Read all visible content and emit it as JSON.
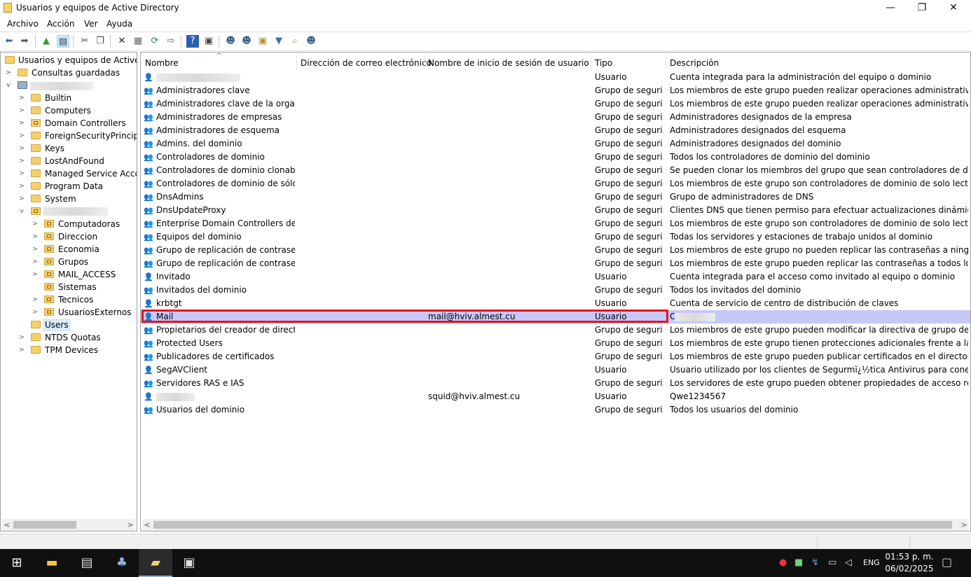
{
  "window": {
    "title": "Usuarios y equipos de Active Directory",
    "minimize": "—",
    "maximize": "❐",
    "close": "✕"
  },
  "menu": [
    "Archivo",
    "Acción",
    "Ver",
    "Ayuda"
  ],
  "toolbar_icons": [
    "back-icon",
    "forward-icon",
    "up-folder-icon",
    "show-hide-tree-icon",
    "cut-icon",
    "copy-icon",
    "delete-icon",
    "properties-icon",
    "refresh-icon",
    "export-list-icon",
    "help-icon",
    "console-tree-icon",
    "new-user-icon",
    "new-group-icon",
    "new-ou-icon",
    "filter-icon",
    "find-icon",
    "add-to-group-icon"
  ],
  "tree": {
    "root": "Usuarios y equipos de Active Directory",
    "items": [
      {
        "label": "Consultas guardadas"
      },
      {
        "label": ""
      },
      {
        "label": "Builtin"
      },
      {
        "label": "Computers"
      },
      {
        "label": "Domain Controllers"
      },
      {
        "label": "ForeignSecurityPrincipals"
      },
      {
        "label": "Keys"
      },
      {
        "label": "LostAndFound"
      },
      {
        "label": "Managed Service Accounts"
      },
      {
        "label": "Program Data"
      },
      {
        "label": "System"
      },
      {
        "label": ""
      },
      {
        "label": "Computadoras"
      },
      {
        "label": "Direccion"
      },
      {
        "label": "Economia"
      },
      {
        "label": "Grupos"
      },
      {
        "label": "MAIL_ACCESS"
      },
      {
        "label": "Sistemas"
      },
      {
        "label": "Tecnicos"
      },
      {
        "label": "UsuariosExternos"
      },
      {
        "label": "Users"
      },
      {
        "label": "NTDS Quotas"
      },
      {
        "label": "TPM Devices"
      }
    ]
  },
  "list": {
    "columns": [
      "Nombre",
      "Dirección de correo electrónico",
      "Nombre de inicio de sesión de usuario",
      "Tipo",
      "Descripción"
    ],
    "rows": [
      {
        "name": "",
        "email": "",
        "login": "",
        "type": "Usuario",
        "desc": "Cuenta integrada para la administración del equipo o dominio",
        "icon": "user"
      },
      {
        "name": "Administradores clave",
        "email": "",
        "login": "",
        "type": "Grupo de seguri...",
        "desc": "Los miembros de este grupo pueden realizar operaciones administrativas en los ...",
        "icon": "group"
      },
      {
        "name": "Administradores clave de la organiz...",
        "email": "",
        "login": "",
        "type": "Grupo de seguri...",
        "desc": "Los miembros de este grupo pueden realizar operaciones administrativas en los ...",
        "icon": "group"
      },
      {
        "name": "Administradores de empresas",
        "email": "",
        "login": "",
        "type": "Grupo de seguri...",
        "desc": "Administradores designados de la empresa",
        "icon": "group"
      },
      {
        "name": "Administradores de esquema",
        "email": "",
        "login": "",
        "type": "Grupo de seguri...",
        "desc": "Administradores designados del esquema",
        "icon": "group"
      },
      {
        "name": "Admins. del dominio",
        "email": "",
        "login": "",
        "type": "Grupo de seguri...",
        "desc": "Administradores designados del dominio",
        "icon": "group"
      },
      {
        "name": "Controladores de dominio",
        "email": "",
        "login": "",
        "type": "Grupo de seguri...",
        "desc": "Todos los controladores de dominio del dominio",
        "icon": "group"
      },
      {
        "name": "Controladores de dominio clonables",
        "email": "",
        "login": "",
        "type": "Grupo de seguri...",
        "desc": "Se pueden clonar los miembros del grupo que sean controladores de dominio.",
        "icon": "group"
      },
      {
        "name": "Controladores de dominio de sólo l...",
        "email": "",
        "login": "",
        "type": "Grupo de seguri...",
        "desc": "Los miembros de este grupo son controladores de dominio de solo lectura en el...",
        "icon": "group"
      },
      {
        "name": "DnsAdmins",
        "email": "",
        "login": "",
        "type": "Grupo de seguri...",
        "desc": "Grupo de administradores de DNS",
        "icon": "group"
      },
      {
        "name": "DnsUpdateProxy",
        "email": "",
        "login": "",
        "type": "Grupo de seguri...",
        "desc": "Clientes DNS que tienen permiso para efectuar actualizaciones dinámicas en no...",
        "icon": "group"
      },
      {
        "name": "Enterprise Domain Controllers de só...",
        "email": "",
        "login": "",
        "type": "Grupo de seguri...",
        "desc": "Los miembros de este grupo son controladores de dominio de solo lectura en la...",
        "icon": "group"
      },
      {
        "name": "Equipos del dominio",
        "email": "",
        "login": "",
        "type": "Grupo de seguri...",
        "desc": "Todas los servidores y estaciones de trabajo unidos al dominio",
        "icon": "group"
      },
      {
        "name": "Grupo de replicación de contraseña...",
        "email": "",
        "login": "",
        "type": "Grupo de seguri...",
        "desc": "Los miembros de este grupo no pueden replicar las contraseñas a ningún contr...",
        "icon": "group"
      },
      {
        "name": "Grupo de replicación de contraseña...",
        "email": "",
        "login": "",
        "type": "Grupo de seguri...",
        "desc": "Los miembros de este grupo pueden replicar las contraseñas a todos los control...",
        "icon": "group"
      },
      {
        "name": "Invitado",
        "email": "",
        "login": "",
        "type": "Usuario",
        "desc": "Cuenta integrada para el acceso como invitado al equipo o dominio",
        "icon": "user-disabled"
      },
      {
        "name": "Invitados del dominio",
        "email": "",
        "login": "",
        "type": "Grupo de seguri...",
        "desc": "Todos los invitados del dominio",
        "icon": "group"
      },
      {
        "name": "krbtgt",
        "email": "",
        "login": "",
        "type": "Usuario",
        "desc": "Cuenta de servicio de centro de distribución de claves",
        "icon": "user-disabled"
      },
      {
        "name": "Mail",
        "email": "",
        "login": "mail@hviv.almest.cu",
        "type": "Usuario",
        "desc": "C",
        "icon": "user"
      },
      {
        "name": "Propietarios del creador de directiva...",
        "email": "",
        "login": "",
        "type": "Grupo de seguri...",
        "desc": "Los miembros de este grupo pueden modificar la directiva de grupo del dominio",
        "icon": "group"
      },
      {
        "name": "Protected Users",
        "email": "",
        "login": "",
        "type": "Grupo de seguri...",
        "desc": "Los miembros de este grupo tienen protecciones adicionales frente a las amena...",
        "icon": "group"
      },
      {
        "name": "Publicadores de certificados",
        "email": "",
        "login": "",
        "type": "Grupo de seguri...",
        "desc": "Los miembros de este grupo pueden publicar certificados en el directorio",
        "icon": "group"
      },
      {
        "name": "SegAVClient",
        "email": "",
        "login": "",
        "type": "Usuario",
        "desc": "Usuario utilizado por los clientes de Segurmï¿½tica Antivirus para conectarse al ...",
        "icon": "user"
      },
      {
        "name": "Servidores RAS e IAS",
        "email": "",
        "login": "",
        "type": "Grupo de seguri...",
        "desc": "Los servidores de este grupo pueden obtener propiedades de acceso remoto de ...",
        "icon": "group"
      },
      {
        "name": "",
        "email": "",
        "login": "squid@hviv.almest.cu",
        "type": "Usuario",
        "desc": "Qwe1234567",
        "icon": "user"
      },
      {
        "name": "Usuarios del dominio",
        "email": "",
        "login": "",
        "type": "Grupo de seguri...",
        "desc": "Todos los usuarios del dominio",
        "icon": "group"
      }
    ]
  },
  "taskbar": {
    "language": "ENG",
    "time": "01:53 p. m.",
    "date": "06/02/2025"
  },
  "colors": {
    "selection": "#c7c8f8",
    "highlight_border": "#e31522",
    "taskbar": "#101010"
  }
}
